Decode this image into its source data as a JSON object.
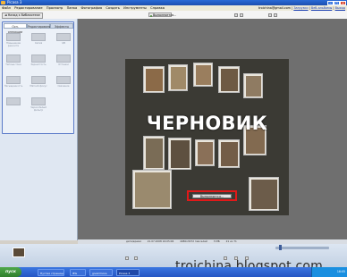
{
  "window": {
    "title": "Picasa 3"
  },
  "menu": {
    "items": [
      "Файл",
      "Редактирование",
      "Просмотр",
      "Папка",
      "Фотография",
      "Создать",
      "Инструменты",
      "Справка"
    ],
    "account_email": "troichina@gmail.com",
    "account_links": [
      "Загрузки",
      "Веб-альбомы",
      "Выход"
    ]
  },
  "toolbar": {
    "back_label": "Назад к библиотеке",
    "progress_label": "Выполняется..."
  },
  "left_panel": {
    "tabs": [
      "Осн. операции",
      "Редактирование",
      "Эффекты"
    ],
    "effects": [
      "Повышение резкости",
      "Сепия",
      "Ч/Б",
      "Теплые тона",
      "Зернистость",
      "Оттенки",
      "Насыщенность",
      "Мягкий фокус",
      "Свечение",
      "Черно-белый фильтр"
    ]
  },
  "canvas": {
    "overlay_text": "ЧЕРНОВИК",
    "busy_text": "Выполняется..."
  },
  "status": {
    "items": [
      "дата/время",
      "21.07.2008 16:05:06",
      "4080x3072 пикселей",
      "3 МБ",
      "21 из 71"
    ]
  },
  "taskbar": {
    "start_label": "пуск",
    "tasks": [
      "Пустая страница",
      "IEG",
      "giveOmore",
      "Picasa 3"
    ],
    "clock": "16:05"
  },
  "watermark": "troichina.blogspot.com"
}
